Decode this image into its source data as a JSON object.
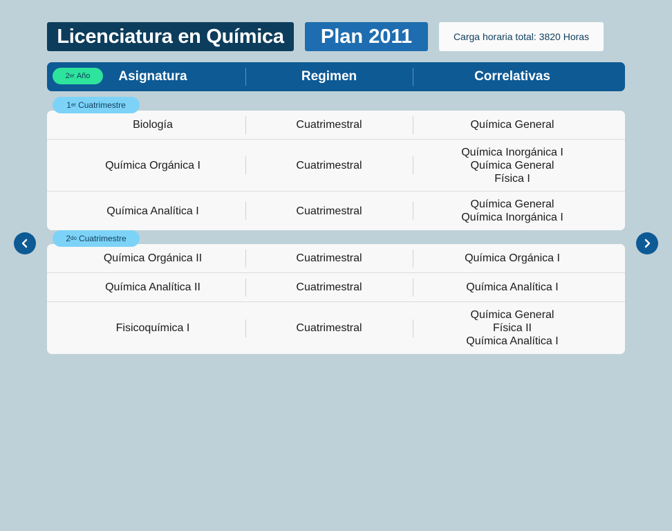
{
  "header": {
    "title": "Licenciatura en Química",
    "plan": "Plan 2011",
    "hours": "Carga horaria total: 3820 Horas"
  },
  "table_header": {
    "year_num": "2",
    "year_sup": "er",
    "year_word": "Año",
    "col1": "Asignatura",
    "col2": "Regimen",
    "col3": "Correlativas"
  },
  "sem1": {
    "num": "1",
    "sup": "er",
    "word": "Cuatrimestre",
    "rows": [
      {
        "subject": "Biología",
        "regime": "Cuatrimestral",
        "corr": [
          "Química General"
        ]
      },
      {
        "subject": "Química Orgánica I",
        "regime": "Cuatrimestral",
        "corr": [
          "Química Inorgánica I",
          "Química General",
          "Física I"
        ]
      },
      {
        "subject": "Química Analítica I",
        "regime": "Cuatrimestral",
        "corr": [
          "Química General",
          "Química Inorgánica I"
        ]
      }
    ]
  },
  "sem2": {
    "num": "2",
    "sup": "do",
    "word": "Cuatrimestre",
    "rows": [
      {
        "subject": "Química Orgánica II",
        "regime": "Cuatrimestral",
        "corr": [
          "Química Orgánica I"
        ]
      },
      {
        "subject": "Química Analítica II",
        "regime": "Cuatrimestral",
        "corr": [
          "Química Analítica I"
        ]
      },
      {
        "subject": "Fisicoquímica I",
        "regime": "Cuatrimestral",
        "corr": [
          "Química General",
          "Física II",
          "Química Analítica I"
        ]
      }
    ]
  },
  "nav": {
    "prev_icon": "chevron-left-icon",
    "next_icon": "chevron-right-icon"
  },
  "colors": {
    "navy": "#0d3d5c",
    "blue": "#1e6db0",
    "header": "#0d5a95",
    "green": "#2ee39b",
    "sky": "#7dd3f7",
    "bg": "#bfd1d8"
  }
}
